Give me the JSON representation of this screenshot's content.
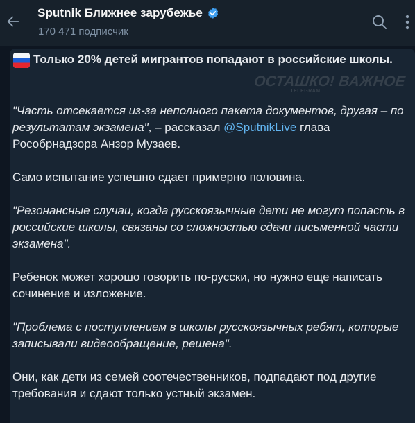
{
  "header": {
    "title": "Sputnik Ближнее зарубежье",
    "subscribers": "170 471 подписчик",
    "back_icon": "arrow-left-icon",
    "verified_icon": "verified-badge-icon",
    "search_icon": "search-icon",
    "menu_icon": "more-vertical-icon"
  },
  "message": {
    "flag_icon": "russian-flag-emoji",
    "headline": "Только 20% детей мигрантов попадают в российские школы.",
    "p2_quote": "\"Часть отсекается из-за неполного пакета документов, другая – по результатам экзамена\"",
    "p2_mid": ", – рассказал ",
    "p2_mention": "@SputnikLive",
    "p2_end": " глава Рособрнадзора Анзор Музаев.",
    "p3": "Само испытание успешно сдает примерно половина.",
    "p4": "\"Резонансные случаи, когда русскоязычные дети не могут попасть в российские школы, связаны со сложностью сдачи письменной части экзамена\".",
    "p5": "Ребенок может хорошо говорить по-русски, но нужно еще написать сочинение и изложение.",
    "p6": "\"Проблема с поступлением в школы русскоязычных ребят, которые записывали видеообращение, решена\".",
    "p7": "Они, как дети из семей соотечественников, подпадают под другие требования и сдают только устный экзамен."
  },
  "watermark": {
    "main": "ОСТАШКО! ВАЖНОЕ",
    "sub": "TELEGRAM"
  },
  "colors": {
    "background": "#0e1621",
    "header": "#17212b",
    "bubble": "#182533",
    "text": "#e6e9ed",
    "muted": "#7f91a4",
    "link": "#62b4ef",
    "verified": "#3f9ff0"
  }
}
